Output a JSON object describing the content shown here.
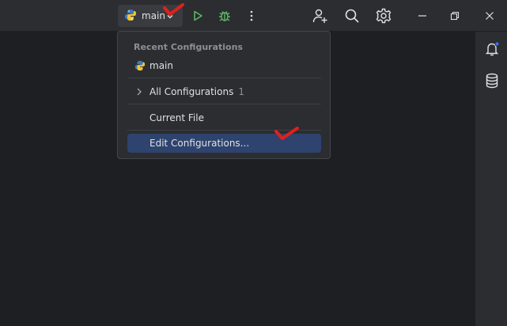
{
  "toolbar": {
    "run_config_label": "main",
    "icons": [
      "python-icon",
      "chevron-down-icon",
      "run-icon",
      "debug-icon",
      "more-icon",
      "add-user-icon",
      "search-icon",
      "settings-icon",
      "minimize-icon",
      "restore-icon",
      "close-icon"
    ]
  },
  "popup": {
    "header": "Recent Configurations",
    "recent_item": "main",
    "all_configurations_label": "All Configurations",
    "all_configurations_count": "1",
    "current_file_label": "Current File",
    "edit_configurations_label": "Edit Configurations..."
  },
  "right_strip": {
    "icons": [
      "notifications-icon",
      "database-icon"
    ]
  },
  "colors": {
    "background": "#1e1f22",
    "panel": "#2b2d30",
    "selected": "#2e436e",
    "run_green": "#5fb865",
    "annotation_red": "#e0201b",
    "notification_dot": "#3574f0"
  }
}
